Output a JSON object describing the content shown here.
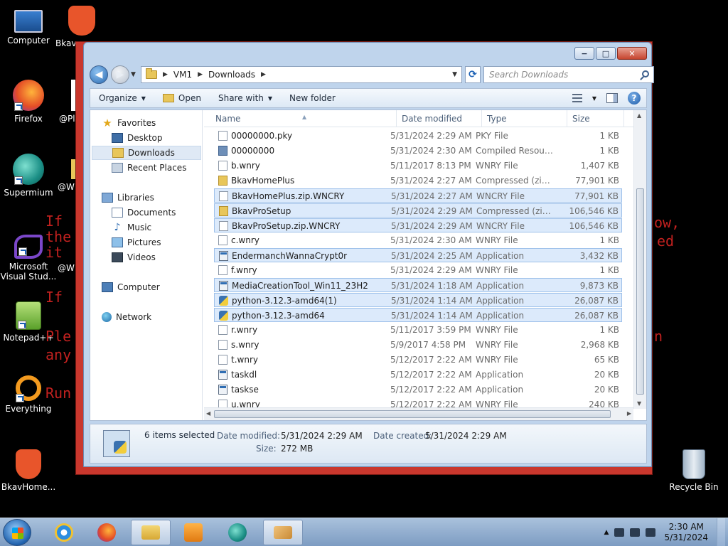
{
  "desktop": {
    "icons": [
      {
        "label": "Computer"
      },
      {
        "label": "Bkav"
      },
      {
        "label": "Firefox"
      },
      {
        "label": "@Pl"
      },
      {
        "label": "Supermium"
      },
      {
        "label": "@W"
      },
      {
        "label": "Microsoft Visual Stud..."
      },
      {
        "label": "@W"
      },
      {
        "label": "Notepad++"
      },
      {
        "label": "Everything"
      },
      {
        "label": "BkavHome..."
      },
      {
        "label": "Recycle Bin"
      }
    ],
    "ransom_lines": [
      "If",
      "the",
      "it",
      "If",
      "Ple",
      "any",
      "Run"
    ],
    "ransom_right": [
      "ow,",
      "ed",
      "n"
    ]
  },
  "window": {
    "caption": {
      "minimize": "−",
      "maximize": "□",
      "close": "✕"
    },
    "breadcrumb": [
      "VM1",
      "Downloads"
    ],
    "search_placeholder": "Search Downloads",
    "toolbar": {
      "organize": "Organize",
      "open": "Open",
      "share_with": "Share with",
      "new_folder": "New folder",
      "help": "?"
    },
    "nav": {
      "favorites": "Favorites",
      "desktop": "Desktop",
      "downloads": "Downloads",
      "recent_places": "Recent Places",
      "libraries": "Libraries",
      "documents": "Documents",
      "music": "Music",
      "pictures": "Pictures",
      "videos": "Videos",
      "computer": "Computer",
      "network": "Network"
    },
    "columns": {
      "name": "Name",
      "date": "Date modified",
      "type": "Type",
      "size": "Size"
    },
    "files": [
      {
        "name": "00000000.pky",
        "date": "5/31/2024 2:29 AM",
        "type": "PKY File",
        "size": "1 KB",
        "icon": "file",
        "selected": false
      },
      {
        "name": "00000000",
        "date": "5/31/2024 2:30 AM",
        "type": "Compiled Resourc...",
        "size": "1 KB",
        "icon": "res",
        "selected": false
      },
      {
        "name": "b.wnry",
        "date": "5/11/2017 8:13 PM",
        "type": "WNRY File",
        "size": "1,407 KB",
        "icon": "file",
        "selected": false
      },
      {
        "name": "BkavHomePlus",
        "date": "5/31/2024 2:27 AM",
        "type": "Compressed (zipp...",
        "size": "77,901 KB",
        "icon": "zip",
        "selected": false
      },
      {
        "name": "BkavHomePlus.zip.WNCRY",
        "date": "5/31/2024 2:27 AM",
        "type": "WNCRY File",
        "size": "77,901 KB",
        "icon": "file",
        "selected": true
      },
      {
        "name": "BkavProSetup",
        "date": "5/31/2024 2:29 AM",
        "type": "Compressed (zipp...",
        "size": "106,546 KB",
        "icon": "zip",
        "selected": true
      },
      {
        "name": "BkavProSetup.zip.WNCRY",
        "date": "5/31/2024 2:29 AM",
        "type": "WNCRY File",
        "size": "106,546 KB",
        "icon": "file",
        "selected": true
      },
      {
        "name": "c.wnry",
        "date": "5/31/2024 2:30 AM",
        "type": "WNRY File",
        "size": "1 KB",
        "icon": "file",
        "selected": false
      },
      {
        "name": "EndermanchWannaCrypt0r",
        "date": "5/31/2024 2:25 AM",
        "type": "Application",
        "size": "3,432 KB",
        "icon": "app",
        "selected": true
      },
      {
        "name": "f.wnry",
        "date": "5/31/2024 2:29 AM",
        "type": "WNRY File",
        "size": "1 KB",
        "icon": "file",
        "selected": false
      },
      {
        "name": "MediaCreationTool_Win11_23H2",
        "date": "5/31/2024 1:18 AM",
        "type": "Application",
        "size": "9,873 KB",
        "icon": "app",
        "selected": true
      },
      {
        "name": "python-3.12.3-amd64(1)",
        "date": "5/31/2024 1:14 AM",
        "type": "Application",
        "size": "26,087 KB",
        "icon": "py",
        "selected": true
      },
      {
        "name": "python-3.12.3-amd64",
        "date": "5/31/2024 1:14 AM",
        "type": "Application",
        "size": "26,087 KB",
        "icon": "py",
        "selected": true
      },
      {
        "name": "r.wnry",
        "date": "5/11/2017 3:59 PM",
        "type": "WNRY File",
        "size": "1 KB",
        "icon": "file",
        "selected": false
      },
      {
        "name": "s.wnry",
        "date": "5/9/2017 4:58 PM",
        "type": "WNRY File",
        "size": "2,968 KB",
        "icon": "file",
        "selected": false
      },
      {
        "name": "t.wnry",
        "date": "5/12/2017 2:22 AM",
        "type": "WNRY File",
        "size": "65 KB",
        "icon": "file",
        "selected": false
      },
      {
        "name": "taskdl",
        "date": "5/12/2017 2:22 AM",
        "type": "Application",
        "size": "20 KB",
        "icon": "app",
        "selected": false
      },
      {
        "name": "taskse",
        "date": "5/12/2017 2:22 AM",
        "type": "Application",
        "size": "20 KB",
        "icon": "app",
        "selected": false
      },
      {
        "name": "u.wnry",
        "date": "5/12/2017 2:22 AM",
        "type": "WNRY File",
        "size": "240 KB",
        "icon": "file",
        "selected": false
      }
    ],
    "details": {
      "selected_count": "6 items selected",
      "modified_label": "Date modified:",
      "modified_value": "5/31/2024 2:29 AM",
      "created_label": "Date created:",
      "created_value": "5/31/2024 2:29 AM",
      "size_label": "Size:",
      "size_value": "272 MB"
    }
  },
  "taskbar": {
    "time": "2:30 AM",
    "date": "5/31/2024"
  },
  "colors": {
    "selection": "#dceafb",
    "window_frame": "#bfd4ec",
    "ransom_red": "#c2211f"
  }
}
